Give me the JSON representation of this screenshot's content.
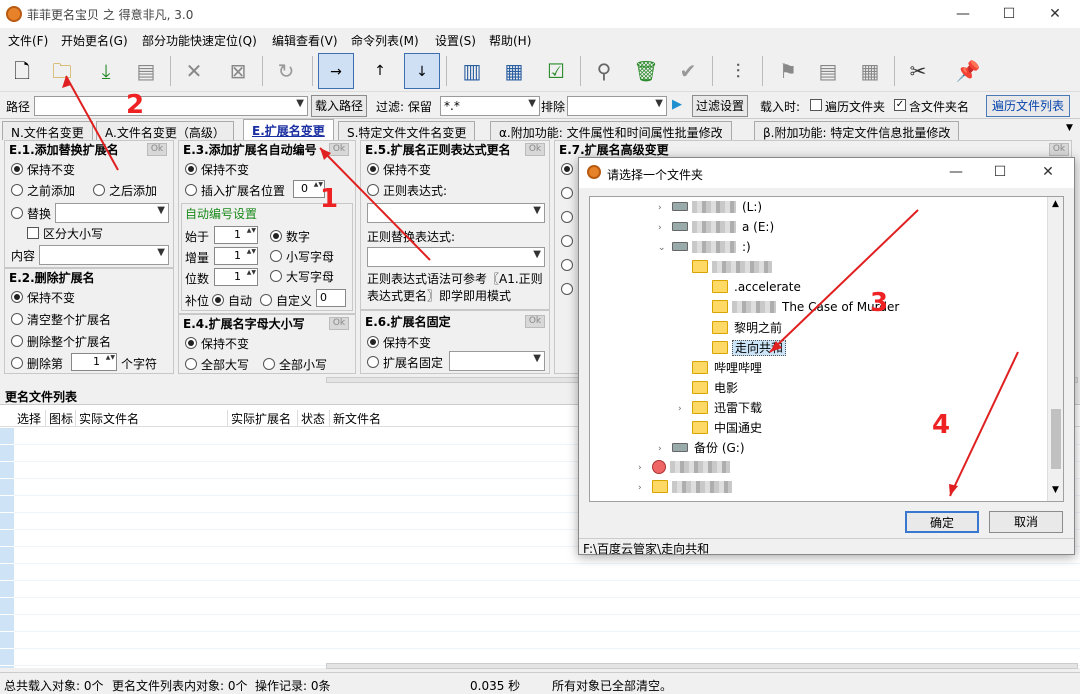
{
  "window": {
    "title": "菲菲更名宝贝 之 得意非凡, 3.0",
    "minimize": "—",
    "maximize": "☐",
    "close": "✕"
  },
  "menu": [
    "文件(F)",
    "开始更名(G)",
    "部分功能快速定位(Q)",
    "编辑查看(V)",
    "命令列表(M)",
    "设置(S)",
    "帮助(H)"
  ],
  "path": {
    "label": "路径",
    "value": "",
    "load_btn": "载入路径",
    "filter_label": "过滤: 保留",
    "filter_value": "*.*",
    "exclude_label": "排除",
    "exclude_value": "",
    "filter_settings_btn": "过滤设置",
    "load_when": "载入时:",
    "traverse_folders": "遍历文件夹",
    "include_folder_name": "含文件夹名",
    "traverse_list_btn": "遍历文件列表"
  },
  "tabs": [
    "N.文件名变更",
    "A.文件名变更（高级）",
    "E.扩展名变更",
    "S.特定文件文件名变更",
    "α.附加功能: 文件属性和时间属性批量修改",
    "β.附加功能: 特定文件信息批量修改"
  ],
  "e1": {
    "title": "E.1.添加替换扩展名",
    "ok": "Ok",
    "keep": "保持不变",
    "before": "之前添加",
    "after": "之后添加",
    "replace": "替换",
    "case": "区分大小写",
    "content": "内容"
  },
  "e2": {
    "title": "E.2.删除扩展名",
    "keep": "保持不变",
    "clear_all": "清空整个扩展名",
    "delete_all": "删除整个扩展名",
    "delete_nth": "删除第",
    "n": "1",
    "chars": "个字符"
  },
  "e3": {
    "title": "E.3.添加扩展名自动编号",
    "ok": "Ok",
    "keep": "保持不变",
    "insert_at": "插入扩展名位置",
    "pos": "0",
    "auto_settings": "自动编号设置",
    "start": "始于",
    "start_v": "1",
    "step": "增量",
    "step_v": "1",
    "digits": "位数",
    "digits_v": "1",
    "pad": "补位",
    "auto": "自动",
    "custom": "自定义",
    "custom_v": "0",
    "numeric": "数字",
    "lower": "小写字母",
    "upper": "大写字母"
  },
  "e4": {
    "title": "E.4.扩展名字母大小写",
    "ok": "Ok",
    "keep": "保持不变",
    "all_upper": "全部大写",
    "all_lower": "全部小写"
  },
  "e5": {
    "title": "E.5.扩展名正则表达式更名",
    "ok": "Ok",
    "keep": "保持不变",
    "regex": "正则表达式:",
    "replace_regex": "正则替换表达式:",
    "note": "正则表达式语法可参考〖A1.正则表达式更名〗即学即用模式"
  },
  "e6": {
    "title": "E.6.扩展名固定",
    "ok": "Ok",
    "keep": "保持不变",
    "fixed": "扩展名固定"
  },
  "e7": {
    "title": "E.7.扩展名高级变更",
    "ok": "Ok"
  },
  "list": {
    "title": "更名文件列表",
    "columns": [
      "选择",
      "图标",
      "实际文件名",
      "实际扩展名",
      "状态",
      "新文件名"
    ]
  },
  "status": {
    "total": "总共载入对象: 0个",
    "in_list": "更名文件列表内对象: 0个",
    "ops": "操作记录: 0条",
    "time": "0.035 秒",
    "msg": "所有对象已全部清空。"
  },
  "dialog": {
    "title": "请选择一个文件夹",
    "tree": [
      {
        "text": "(L:)",
        "level": 1,
        "kind": "drive",
        "blur": true
      },
      {
        "text": "a (E:)",
        "level": 1,
        "kind": "drive",
        "blur": true
      },
      {
        "text": ":)",
        "level": 1,
        "kind": "drive",
        "blur": true,
        "expanded": true
      },
      {
        "text": "",
        "level": 2,
        "kind": "folder",
        "blur": true
      },
      {
        "text": ".accelerate",
        "level": 3,
        "kind": "folder"
      },
      {
        "text": "The Case of Murder",
        "level": 3,
        "kind": "folder",
        "blur": true
      },
      {
        "text": "黎明之前",
        "level": 3,
        "kind": "folder"
      },
      {
        "text": "走向共和",
        "level": 3,
        "kind": "folder",
        "selected": true
      },
      {
        "text": "哔哩哔哩",
        "level": 2,
        "kind": "folder"
      },
      {
        "text": "电影",
        "level": 2,
        "kind": "folder"
      },
      {
        "text": "迅雷下载",
        "level": 2,
        "kind": "folder"
      },
      {
        "text": "中国通史",
        "level": 2,
        "kind": "folder"
      },
      {
        "text": "备份 (G:)",
        "level": 1,
        "kind": "drive"
      },
      {
        "text": "",
        "level": 0,
        "kind": "user",
        "blur": true
      },
      {
        "text": "",
        "level": 0,
        "kind": "folder",
        "blur": true
      }
    ],
    "ok": "确定",
    "cancel": "取消",
    "path": "F:\\百度云管家\\走向共和"
  },
  "annotations": [
    "1",
    "2",
    "3",
    "4"
  ]
}
